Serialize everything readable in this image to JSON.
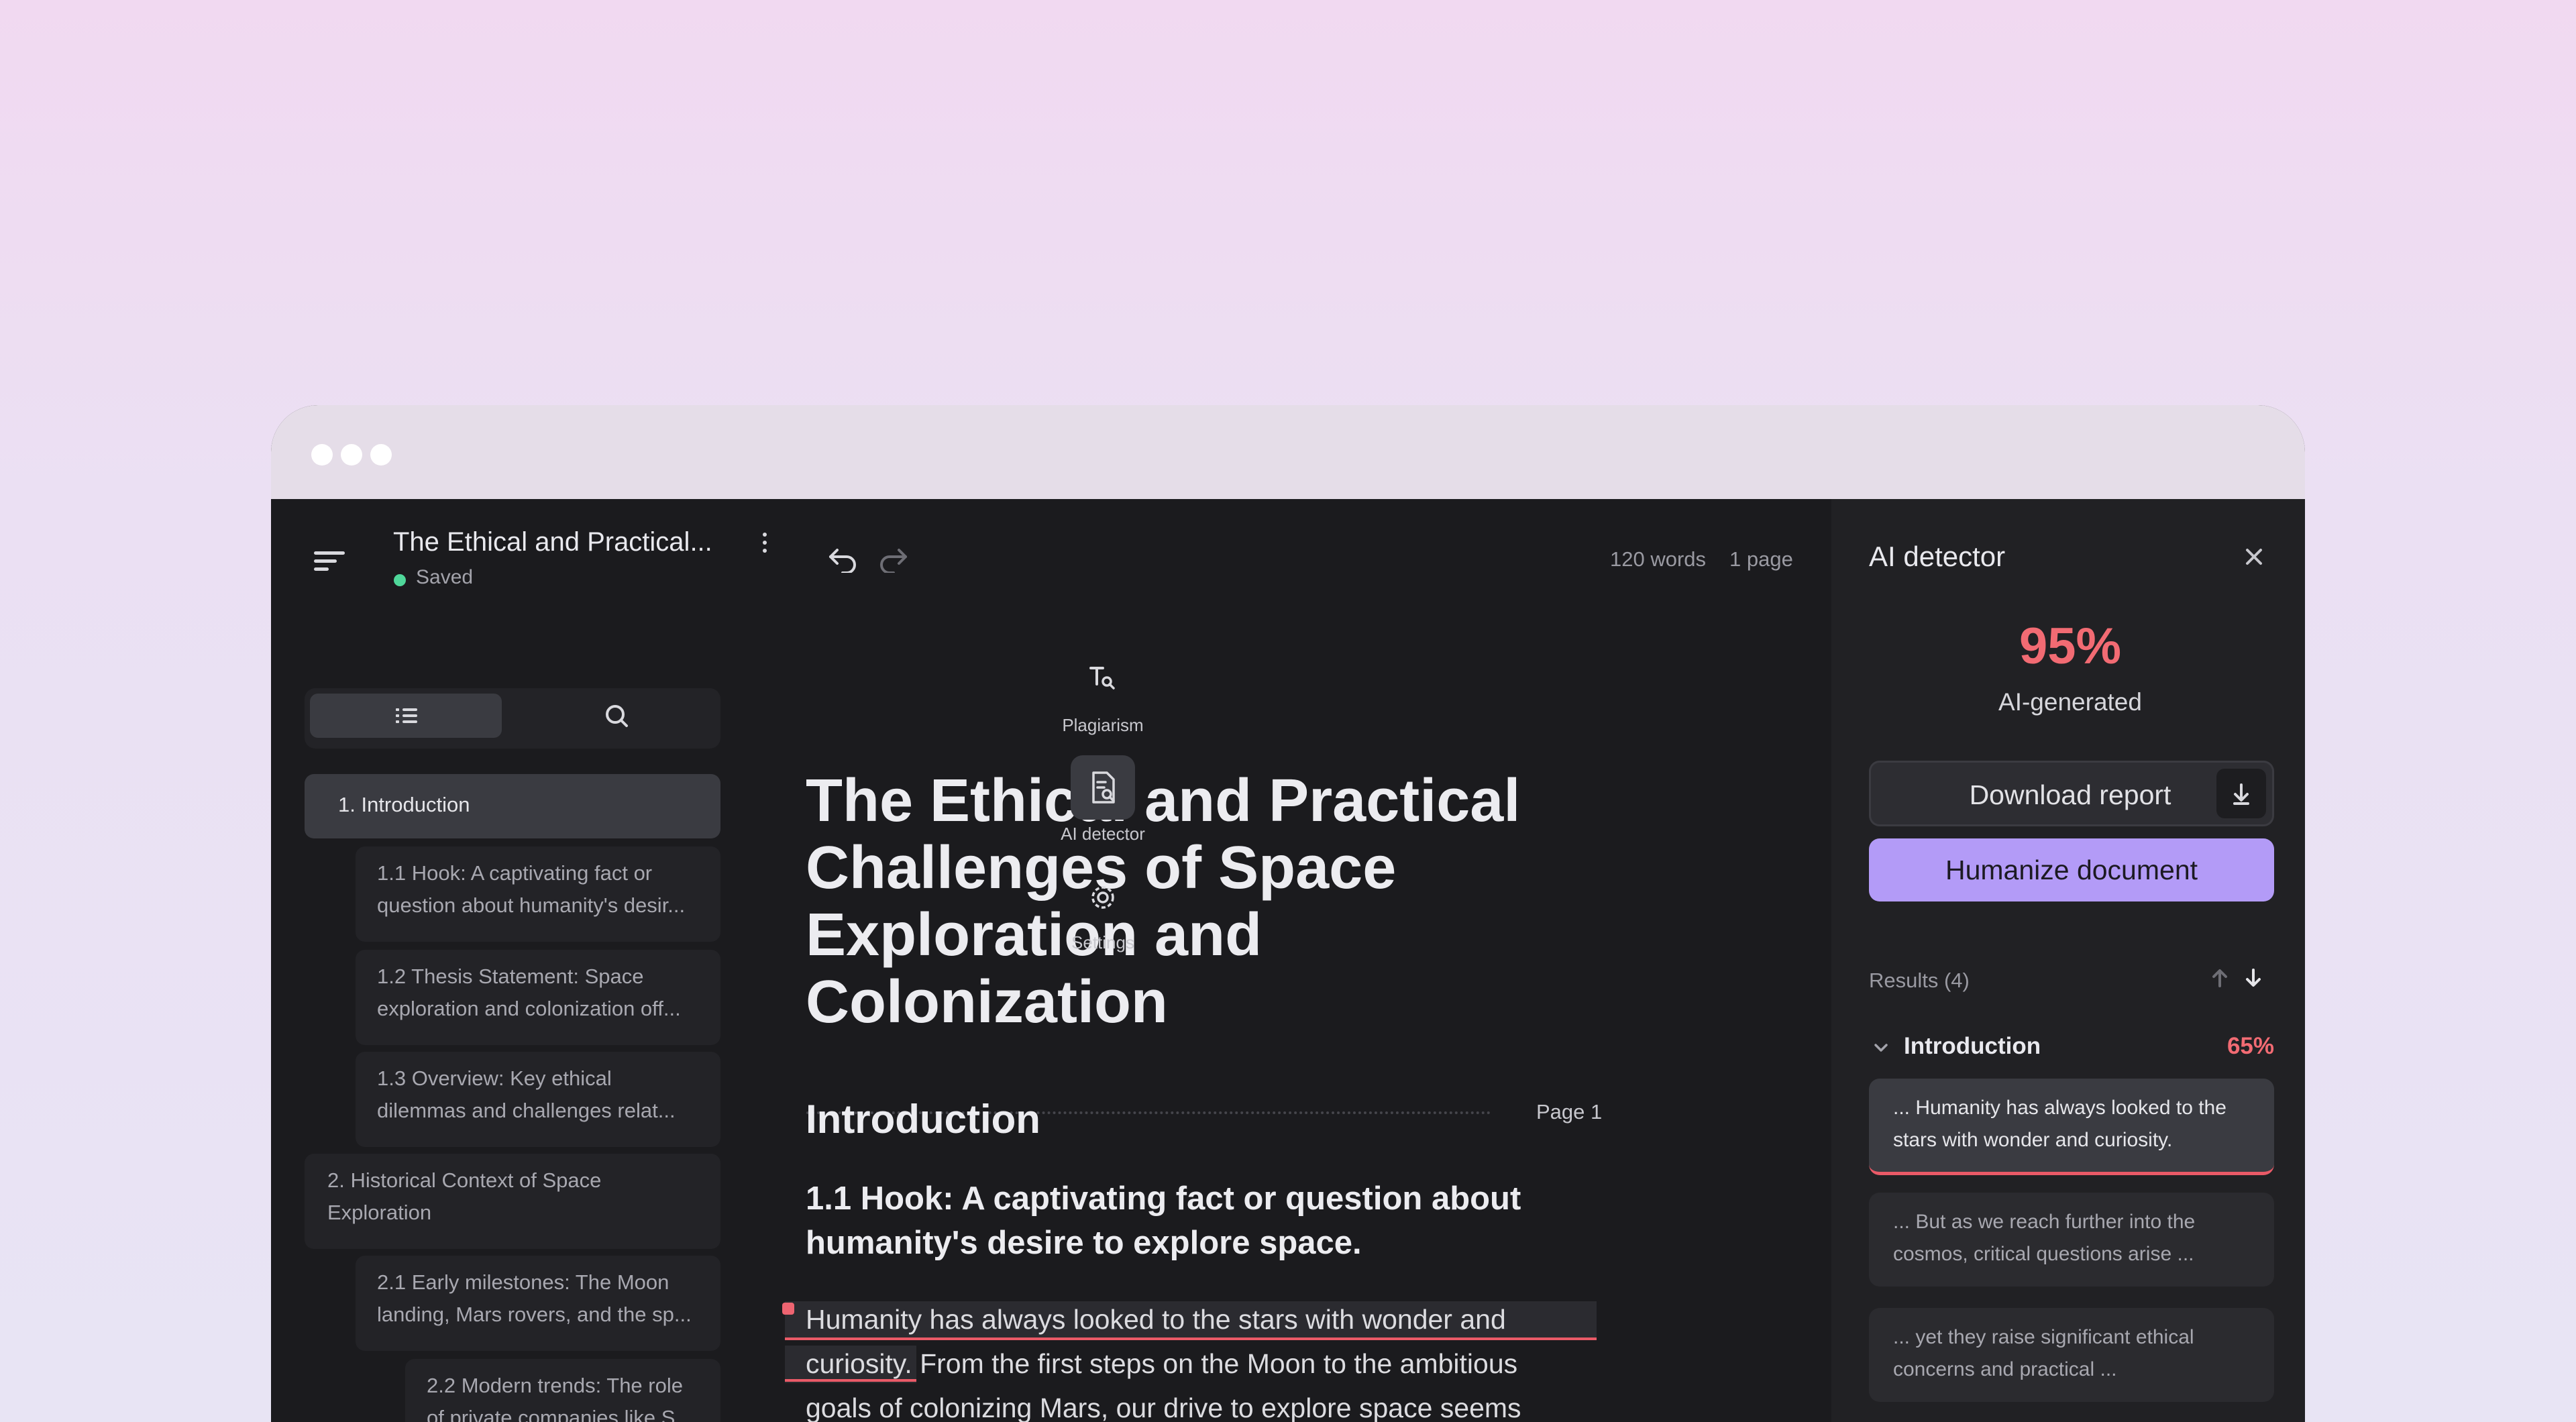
{
  "window": {
    "dots": [
      "window-dot-1",
      "window-dot-2",
      "window-dot-3"
    ]
  },
  "header": {
    "doc_title": "The Ethical and Practical...",
    "status": "Saved",
    "word_count": "120 words",
    "page_count": "1 page"
  },
  "outline": {
    "items": [
      {
        "line1": "1. Introduction",
        "line2": ""
      },
      {
        "line1": "1.1 Hook: A captivating fact or",
        "line2": "question about humanity's desir..."
      },
      {
        "line1": "1.2 Thesis Statement: Space",
        "line2": "exploration and colonization off..."
      },
      {
        "line1": "1.3 Overview: Key ethical",
        "line2": "dilemmas and challenges relat..."
      },
      {
        "line1": "2. Historical Context of Space",
        "line2": "Exploration"
      },
      {
        "line1": "2.1 Early milestones: The Moon",
        "line2": "landing, Mars rovers, and the sp..."
      },
      {
        "line1": "2.2 Modern trends: The role",
        "line2": "of private companies like S..."
      }
    ]
  },
  "editor": {
    "page_label": "Page 1",
    "title": "The Ethical and Practical Challenges of Space Exploration and Colonization",
    "section_heading": "Introduction",
    "subheading": "1.1 Hook: A captivating fact or question about humanity's desire to explore space.",
    "para_line1": "Humanity has always looked to the stars with wonder and",
    "para_line2": "curiosity. From the first steps on the Moon to the ambitious",
    "para_line3": "goals of colonizing Mars, our drive to explore space seems"
  },
  "tools": {
    "plagiarism": "Plagiarism",
    "ai_detector": "AI detector",
    "settings": "Settings"
  },
  "panel": {
    "title": "AI detector",
    "score": "95%",
    "score_label": "AI-generated",
    "download_label": "Download report",
    "humanize_label": "Humanize document",
    "results_label": "Results (4)",
    "section_title": "Introduction",
    "section_pct": "65%",
    "results": [
      {
        "line1": "... Humanity has always looked to the",
        "line2": "stars with wonder and curiosity."
      },
      {
        "line1": "... But as we reach further into the",
        "line2": "cosmos, critical questions arise ..."
      },
      {
        "line1": "... yet they raise significant ethical",
        "line2": "concerns and practical ..."
      }
    ]
  },
  "colors": {
    "accent": "#b39bf7",
    "danger": "#f26b73",
    "saved": "#4fd79a"
  }
}
